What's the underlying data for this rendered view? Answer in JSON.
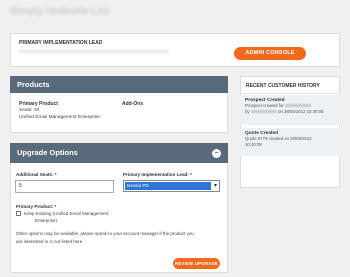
{
  "page": {
    "title": "Simply Umbrella List"
  },
  "lead_panel": {
    "label": "PRIMARY IMPLEMENTATION LEAD",
    "admin_button": "ADMIN CONSOLE"
  },
  "products": {
    "heading": "Products",
    "primary_product_label": "Primary Product",
    "seats_text": "Seats: 30",
    "product_name": "Unified Email Management Enterprise",
    "addons_label": "Add-Ons"
  },
  "history": {
    "heading": "RECENT CUSTOMER HISTORY",
    "items": [
      {
        "title": "Prospect Created",
        "line1": "Prospect created for",
        "line2_prefix": "by",
        "line2_suffix": "on 28/09/2012 10:40:08"
      },
      {
        "title": "Quote Created",
        "line1": "Quote 8776 created on 28/09/2012",
        "line2": "10:40:08"
      }
    ]
  },
  "upgrade": {
    "heading": "Upgrade Options",
    "additional_seats_label": "Additional Seats: *",
    "additional_seats_value": "5",
    "lead_label": "Primary Implementation Lead: *",
    "lead_value": "Nexsia PD",
    "primary_product_label": "Primary Product: *",
    "keep_existing_line1": "Keep Existing (Unified Email Management",
    "keep_existing_line2": "Enterprise)",
    "other_options_line1": "Other options may be available, please speak to your account manager if the product you",
    "other_options_line2": "are interested in is not listed here",
    "review_button": "REVIEW UPGRADE"
  }
}
